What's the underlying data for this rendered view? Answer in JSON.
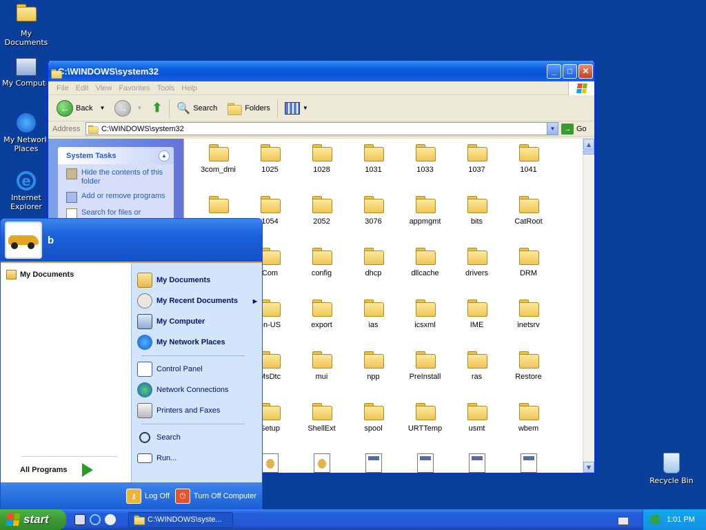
{
  "desktop": {
    "icons": [
      {
        "label": "My Documents"
      },
      {
        "label": "My Compute"
      },
      {
        "label": "My Network Places"
      },
      {
        "label": "Internet Explorer"
      },
      {
        "label": "Recycle Bin"
      }
    ]
  },
  "window": {
    "title": "C:\\WINDOWS\\system32",
    "menus": [
      "File",
      "Edit",
      "View",
      "Favorites",
      "Tools",
      "Help"
    ],
    "toolbar": {
      "back": "Back",
      "search": "Search",
      "folders": "Folders"
    },
    "address": {
      "label": "Address",
      "value": "C:\\WINDOWS\\system32",
      "go": "Go"
    },
    "taskpane": {
      "title": "System Tasks",
      "items": [
        "Hide the contents of this folder",
        "Add or remove programs",
        "Search for files or"
      ]
    },
    "files": [
      "3com_dmi",
      "1025",
      "1028",
      "1031",
      "1033",
      "1037",
      "1041",
      "",
      "1054",
      "2052",
      "3076",
      "appmgmt",
      "bits",
      "CatRoot",
      "",
      "Com",
      "config",
      "dhcp",
      "dllcache",
      "drivers",
      "DRM",
      "",
      "en-US",
      "export",
      "ias",
      "icsxml",
      "IME",
      "inetsrv",
      "",
      "MsDtc",
      "mui",
      "npp",
      "PreInstall",
      "ras",
      "Restore",
      "",
      "Setup",
      "ShellExt",
      "spool",
      "URTTemp",
      "usmt",
      "wbem",
      "",
      "",
      "",
      "",
      "",
      "",
      ""
    ]
  },
  "startmenu": {
    "user": "b",
    "left": {
      "pinned": "My Documents",
      "all_programs": "All Programs"
    },
    "right": {
      "group1": [
        "My Documents",
        "My Recent Documents",
        "My Computer",
        "My Network Places"
      ],
      "group2": [
        "Control Panel",
        "Network Connections",
        "Printers and Faxes"
      ],
      "group3": [
        "Search",
        "Run..."
      ]
    },
    "footer": {
      "logoff": "Log Off",
      "turnoff": "Turn Off Computer"
    }
  },
  "taskbar": {
    "start": "start",
    "task_label": "C:\\WINDOWS\\syste...",
    "clock": "1:01 PM"
  }
}
